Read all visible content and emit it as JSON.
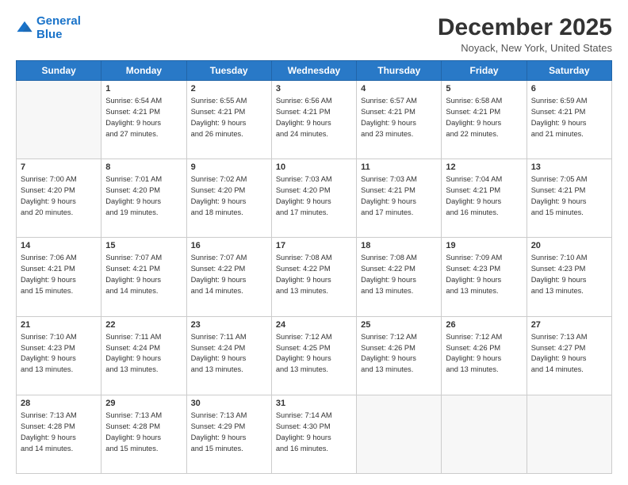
{
  "logo": {
    "line1": "General",
    "line2": "Blue"
  },
  "header": {
    "title": "December 2025",
    "location": "Noyack, New York, United States"
  },
  "weekdays": [
    "Sunday",
    "Monday",
    "Tuesday",
    "Wednesday",
    "Thursday",
    "Friday",
    "Saturday"
  ],
  "weeks": [
    [
      {
        "day": "",
        "info": ""
      },
      {
        "day": "1",
        "info": "Sunrise: 6:54 AM\nSunset: 4:21 PM\nDaylight: 9 hours\nand 27 minutes."
      },
      {
        "day": "2",
        "info": "Sunrise: 6:55 AM\nSunset: 4:21 PM\nDaylight: 9 hours\nand 26 minutes."
      },
      {
        "day": "3",
        "info": "Sunrise: 6:56 AM\nSunset: 4:21 PM\nDaylight: 9 hours\nand 24 minutes."
      },
      {
        "day": "4",
        "info": "Sunrise: 6:57 AM\nSunset: 4:21 PM\nDaylight: 9 hours\nand 23 minutes."
      },
      {
        "day": "5",
        "info": "Sunrise: 6:58 AM\nSunset: 4:21 PM\nDaylight: 9 hours\nand 22 minutes."
      },
      {
        "day": "6",
        "info": "Sunrise: 6:59 AM\nSunset: 4:21 PM\nDaylight: 9 hours\nand 21 minutes."
      }
    ],
    [
      {
        "day": "7",
        "info": "Sunrise: 7:00 AM\nSunset: 4:20 PM\nDaylight: 9 hours\nand 20 minutes."
      },
      {
        "day": "8",
        "info": "Sunrise: 7:01 AM\nSunset: 4:20 PM\nDaylight: 9 hours\nand 19 minutes."
      },
      {
        "day": "9",
        "info": "Sunrise: 7:02 AM\nSunset: 4:20 PM\nDaylight: 9 hours\nand 18 minutes."
      },
      {
        "day": "10",
        "info": "Sunrise: 7:03 AM\nSunset: 4:20 PM\nDaylight: 9 hours\nand 17 minutes."
      },
      {
        "day": "11",
        "info": "Sunrise: 7:03 AM\nSunset: 4:21 PM\nDaylight: 9 hours\nand 17 minutes."
      },
      {
        "day": "12",
        "info": "Sunrise: 7:04 AM\nSunset: 4:21 PM\nDaylight: 9 hours\nand 16 minutes."
      },
      {
        "day": "13",
        "info": "Sunrise: 7:05 AM\nSunset: 4:21 PM\nDaylight: 9 hours\nand 15 minutes."
      }
    ],
    [
      {
        "day": "14",
        "info": "Sunrise: 7:06 AM\nSunset: 4:21 PM\nDaylight: 9 hours\nand 15 minutes."
      },
      {
        "day": "15",
        "info": "Sunrise: 7:07 AM\nSunset: 4:21 PM\nDaylight: 9 hours\nand 14 minutes."
      },
      {
        "day": "16",
        "info": "Sunrise: 7:07 AM\nSunset: 4:22 PM\nDaylight: 9 hours\nand 14 minutes."
      },
      {
        "day": "17",
        "info": "Sunrise: 7:08 AM\nSunset: 4:22 PM\nDaylight: 9 hours\nand 13 minutes."
      },
      {
        "day": "18",
        "info": "Sunrise: 7:08 AM\nSunset: 4:22 PM\nDaylight: 9 hours\nand 13 minutes."
      },
      {
        "day": "19",
        "info": "Sunrise: 7:09 AM\nSunset: 4:23 PM\nDaylight: 9 hours\nand 13 minutes."
      },
      {
        "day": "20",
        "info": "Sunrise: 7:10 AM\nSunset: 4:23 PM\nDaylight: 9 hours\nand 13 minutes."
      }
    ],
    [
      {
        "day": "21",
        "info": "Sunrise: 7:10 AM\nSunset: 4:23 PM\nDaylight: 9 hours\nand 13 minutes."
      },
      {
        "day": "22",
        "info": "Sunrise: 7:11 AM\nSunset: 4:24 PM\nDaylight: 9 hours\nand 13 minutes."
      },
      {
        "day": "23",
        "info": "Sunrise: 7:11 AM\nSunset: 4:24 PM\nDaylight: 9 hours\nand 13 minutes."
      },
      {
        "day": "24",
        "info": "Sunrise: 7:12 AM\nSunset: 4:25 PM\nDaylight: 9 hours\nand 13 minutes."
      },
      {
        "day": "25",
        "info": "Sunrise: 7:12 AM\nSunset: 4:26 PM\nDaylight: 9 hours\nand 13 minutes."
      },
      {
        "day": "26",
        "info": "Sunrise: 7:12 AM\nSunset: 4:26 PM\nDaylight: 9 hours\nand 13 minutes."
      },
      {
        "day": "27",
        "info": "Sunrise: 7:13 AM\nSunset: 4:27 PM\nDaylight: 9 hours\nand 14 minutes."
      }
    ],
    [
      {
        "day": "28",
        "info": "Sunrise: 7:13 AM\nSunset: 4:28 PM\nDaylight: 9 hours\nand 14 minutes."
      },
      {
        "day": "29",
        "info": "Sunrise: 7:13 AM\nSunset: 4:28 PM\nDaylight: 9 hours\nand 15 minutes."
      },
      {
        "day": "30",
        "info": "Sunrise: 7:13 AM\nSunset: 4:29 PM\nDaylight: 9 hours\nand 15 minutes."
      },
      {
        "day": "31",
        "info": "Sunrise: 7:14 AM\nSunset: 4:30 PM\nDaylight: 9 hours\nand 16 minutes."
      },
      {
        "day": "",
        "info": ""
      },
      {
        "day": "",
        "info": ""
      },
      {
        "day": "",
        "info": ""
      }
    ]
  ]
}
